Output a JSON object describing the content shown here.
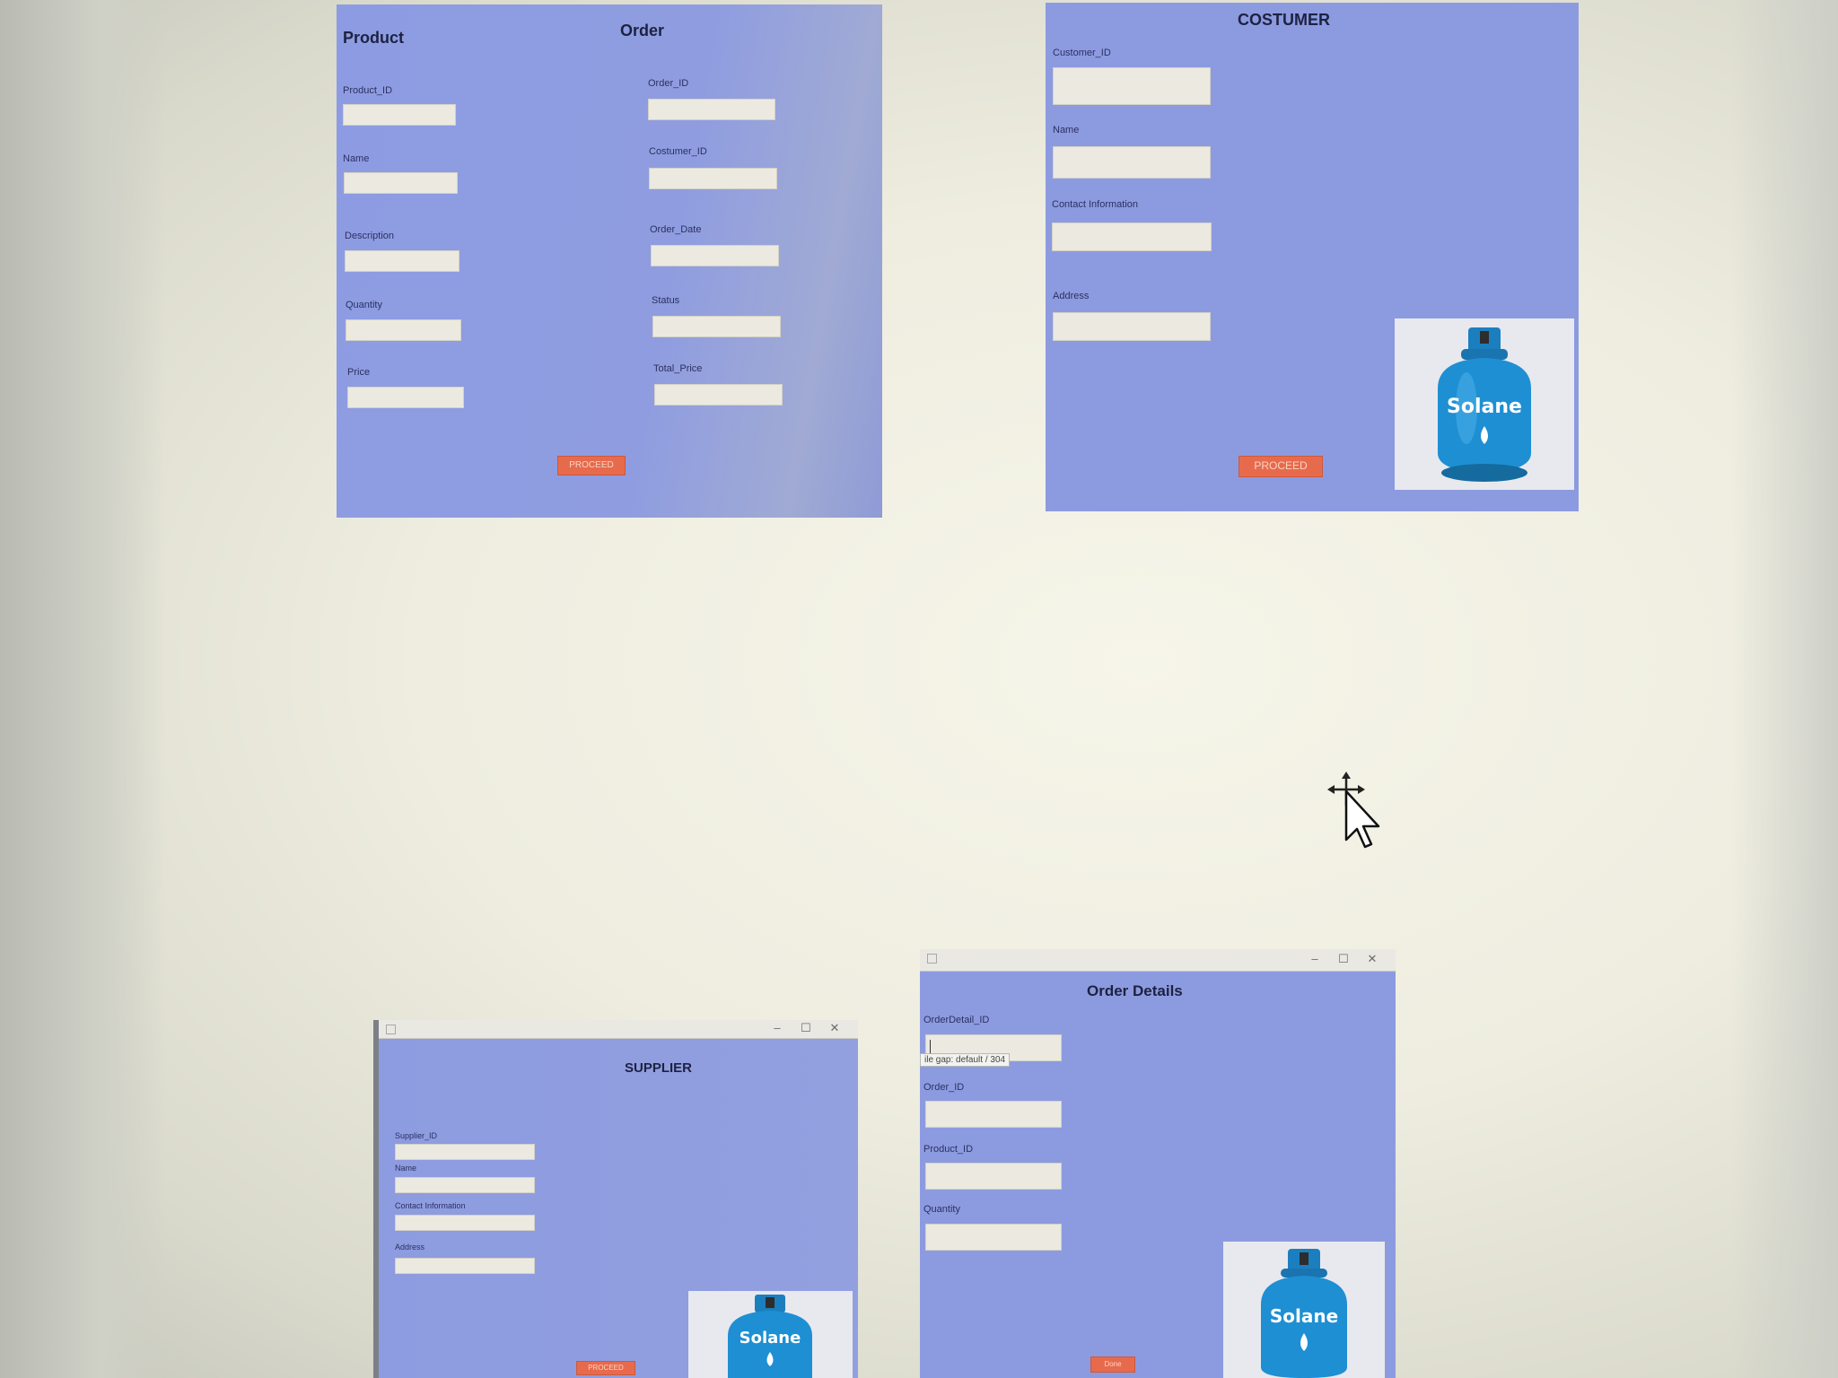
{
  "product": {
    "title": "Product",
    "fields": [
      "Product_ID",
      "Name",
      "Description",
      "Quantity",
      "Price"
    ]
  },
  "order": {
    "title": "Order",
    "fields": [
      "Order_ID",
      "Costumer_ID",
      "Order_Date",
      "Status",
      "Total_Price"
    ],
    "proceed_label": "PROCEED"
  },
  "costumer": {
    "title": "COSTUMER",
    "fields": [
      "Customer_ID",
      "Name",
      "Contact Information",
      "Address"
    ],
    "proceed_label": "PROCEED",
    "logo_text": "Solane"
  },
  "supplier": {
    "title": "SUPPLIER",
    "fields": [
      "Supplier_ID",
      "Name",
      "Contact Information",
      "Address"
    ],
    "proceed_label": "PROCEED",
    "logo_text": "Solane",
    "window_controls": [
      "–",
      "☐",
      "✕"
    ]
  },
  "order_details": {
    "title": "Order Details",
    "fields": [
      "OrderDetail_ID",
      "Order_ID",
      "Product_ID",
      "Quantity"
    ],
    "tooltip": "ile gap: default / 304",
    "button_label": "Done",
    "logo_text": "Solane",
    "window_controls": [
      "–",
      "☐",
      "✕"
    ]
  }
}
